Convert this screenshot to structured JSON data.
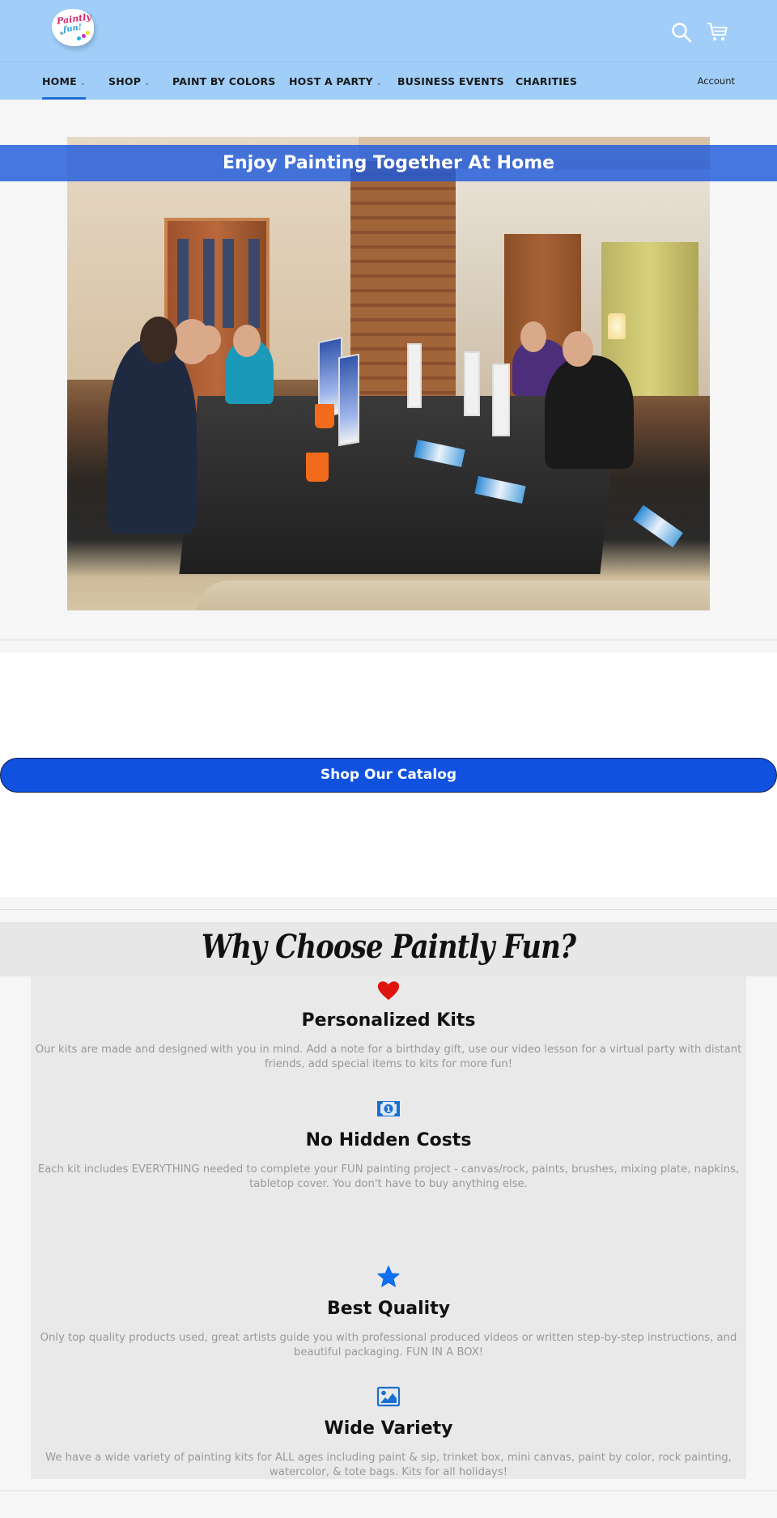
{
  "header": {
    "logo": {
      "line1": "Paintly",
      "line2": "fun!",
      "alt": "Paintly Fun logo"
    },
    "icons": {
      "search": "search-icon",
      "cart": "cart-icon"
    }
  },
  "nav": {
    "items": [
      {
        "label": "HOME",
        "has_dropdown": true,
        "active": true
      },
      {
        "label": "SHOP",
        "has_dropdown": true,
        "active": false
      },
      {
        "label": "PAINT BY COLORS",
        "has_dropdown": false,
        "active": false
      },
      {
        "label": "HOST A PARTY",
        "has_dropdown": true,
        "active": false
      },
      {
        "label": "BUSINESS EVENTS",
        "has_dropdown": false,
        "active": false
      },
      {
        "label": "CHARITIES",
        "has_dropdown": false,
        "active": false
      }
    ],
    "chevron": "⌄",
    "account_label": "Account",
    "active_color": "#1a6fd1"
  },
  "hero": {
    "banner_text": "Enjoy Painting Together At Home",
    "image_description": "Group of friends painting on canvases around a dining table at home"
  },
  "catalog": {
    "button_label": "Shop Our Catalog",
    "button_color": "#1051e0"
  },
  "why": {
    "title": "Why Choose Paintly Fun?",
    "features": [
      {
        "icon": "heart-icon",
        "icon_color": "#e0140f",
        "title": "Personalized Kits",
        "text": "Our kits are made and designed with you in mind. Add a note for a birthday gift, use our video lesson for a virtual party with distant friends, add special items to kits for more fun!"
      },
      {
        "icon": "money-bill-icon",
        "icon_color": "#1a6fd1",
        "title": "No Hidden Costs",
        "text": "Each kit includes EVERYTHING needed to complete your FUN painting project - canvas/rock, paints, brushes, mixing plate, napkins, tabletop cover. You don't have to buy anything else."
      },
      {
        "icon": "star-icon",
        "icon_color": "#0f6ff0",
        "title": "Best Quality",
        "text": "Only top quality products used, great artists guide you with professional produced videos or written step-by-step instructions, and beautiful packaging. FUN IN A BOX!"
      },
      {
        "icon": "image-icon",
        "icon_color": "#1a6fd1",
        "title": "Wide Variety",
        "text": "We have a wide variety of painting kits for ALL ages including paint & sip, trinket box, mini canvas, paint by color, rock painting, watercolor, & tote bags. Kits for all holidays!"
      }
    ]
  }
}
